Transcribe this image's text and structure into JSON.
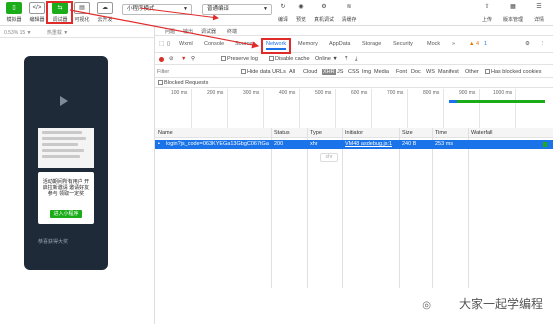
{
  "toolbar": {
    "simulator": "模拟器",
    "editor": "编辑器",
    "debugger": "调试器",
    "visual": "可视化",
    "cloud": "云开发",
    "mode_select": "小程序模式",
    "compile_select": "普通编译",
    "compile": "编译",
    "preview": "预览",
    "real_debug": "真机调试",
    "clear_cache": "清缓存",
    "upload": "上传",
    "version": "版本管理",
    "details": "详情"
  },
  "simulator": {
    "device_label": "0.53% 15 ▼",
    "network_label": "热重载 ▼",
    "modal_text": "活动期间所有用户 开启拉新邀请 邀请好友参与 领取一定奖",
    "modal_button": "进入小程序",
    "bottom_text": "恭喜获得大奖"
  },
  "devtools": {
    "subtabs": [
      "问题",
      "输出",
      "调试器",
      "终端"
    ],
    "tabs": [
      "Wxml",
      "Console",
      "Sources",
      "Network",
      "Memory",
      "AppData",
      "Storage",
      "Security",
      "Mock"
    ],
    "active_tab": "Network",
    "more": "»",
    "warn_count": "▲ 4",
    "err_count": "1",
    "preserve_log": "Preserve log",
    "disable_cache": "Disable cache",
    "throttle": "Online",
    "filter_placeholder": "Filter",
    "hide_data_urls": "Hide data URLs",
    "types": [
      "All",
      "Cloud",
      "XHR",
      "JS",
      "CSS",
      "Img",
      "Media",
      "Font",
      "Doc",
      "WS",
      "Manifest",
      "Other"
    ],
    "active_type": "XHR",
    "blocked_cookies": "Has blocked cookies",
    "blocked_requests": "Blocked Requests",
    "ticks": [
      "100 ms",
      "200 ms",
      "300 ms",
      "400 ms",
      "500 ms",
      "600 ms",
      "700 ms",
      "800 ms",
      "900 ms",
      "1000 ms"
    ],
    "columns": [
      "Name",
      "Status",
      "Type",
      "Initiator",
      "Size",
      "Time",
      "Waterfall"
    ],
    "request": {
      "name": "login?js_code=063KYEGa13GbgC067tGa...",
      "status": "200",
      "type": "xhr",
      "initiator": "VM48 asdebug.js:1",
      "size": "240 B",
      "time": "253 ms"
    },
    "request_summary": "xhr"
  },
  "watermark": "大家一起学编程",
  "colors": {
    "accent": "#1a73e8",
    "highlight": "#e02b2b",
    "brand_green": "#1aad19"
  }
}
